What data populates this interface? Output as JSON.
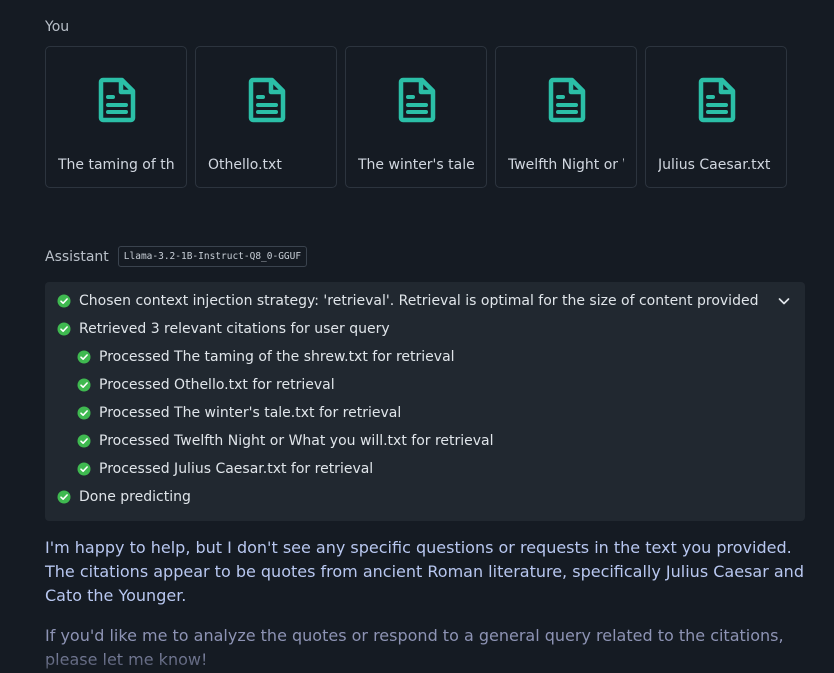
{
  "user": {
    "label": "You",
    "files": [
      {
        "name": "The taming of the shrew.txt",
        "icon": "document-icon"
      },
      {
        "name": "Othello.txt",
        "icon": "document-icon"
      },
      {
        "name": "The winter's tale.txt",
        "icon": "document-icon"
      },
      {
        "name": "Twelfth Night or What you will.txt",
        "icon": "document-icon"
      },
      {
        "name": "Julius Caesar.txt",
        "icon": "document-icon"
      }
    ]
  },
  "assistant": {
    "label": "Assistant",
    "model": "Llama-3.2-1B-Instruct-Q8_0-GGUF",
    "status_steps": [
      {
        "text": "Chosen context injection strategy: 'retrieval'. Retrieval is optimal for the size of content provided",
        "level": 0,
        "icon": "check-circle-icon"
      },
      {
        "text": "Retrieved 3 relevant citations for user query",
        "level": 0,
        "icon": "check-circle-icon"
      },
      {
        "text": "Processed The taming of the shrew.txt for retrieval",
        "level": 1,
        "icon": "check-circle-icon"
      },
      {
        "text": "Processed Othello.txt for retrieval",
        "level": 1,
        "icon": "check-circle-icon"
      },
      {
        "text": "Processed The winter's tale.txt for retrieval",
        "level": 1,
        "icon": "check-circle-icon"
      },
      {
        "text": "Processed Twelfth Night or What you will.txt for retrieval",
        "level": 1,
        "icon": "check-circle-icon"
      },
      {
        "text": "Processed Julius Caesar.txt for retrieval",
        "level": 1,
        "icon": "check-circle-icon"
      },
      {
        "text": "Done predicting",
        "level": 0,
        "icon": "check-circle-icon"
      }
    ],
    "response": [
      "I'm happy to help, but I don't see any specific questions or requests in the text you provided. The citations appear to be quotes from ancient Roman literature, specifically Julius Caesar and Cato the Younger.",
      "If you'd like me to analyze the quotes or respond to a general query related to the citations, please let me know!"
    ]
  },
  "colors": {
    "background": "#151b23",
    "panel": "#212830",
    "accent_teal": "#2bbfa7",
    "success_green": "#3fb950",
    "response_text": "#b8c7f0"
  }
}
